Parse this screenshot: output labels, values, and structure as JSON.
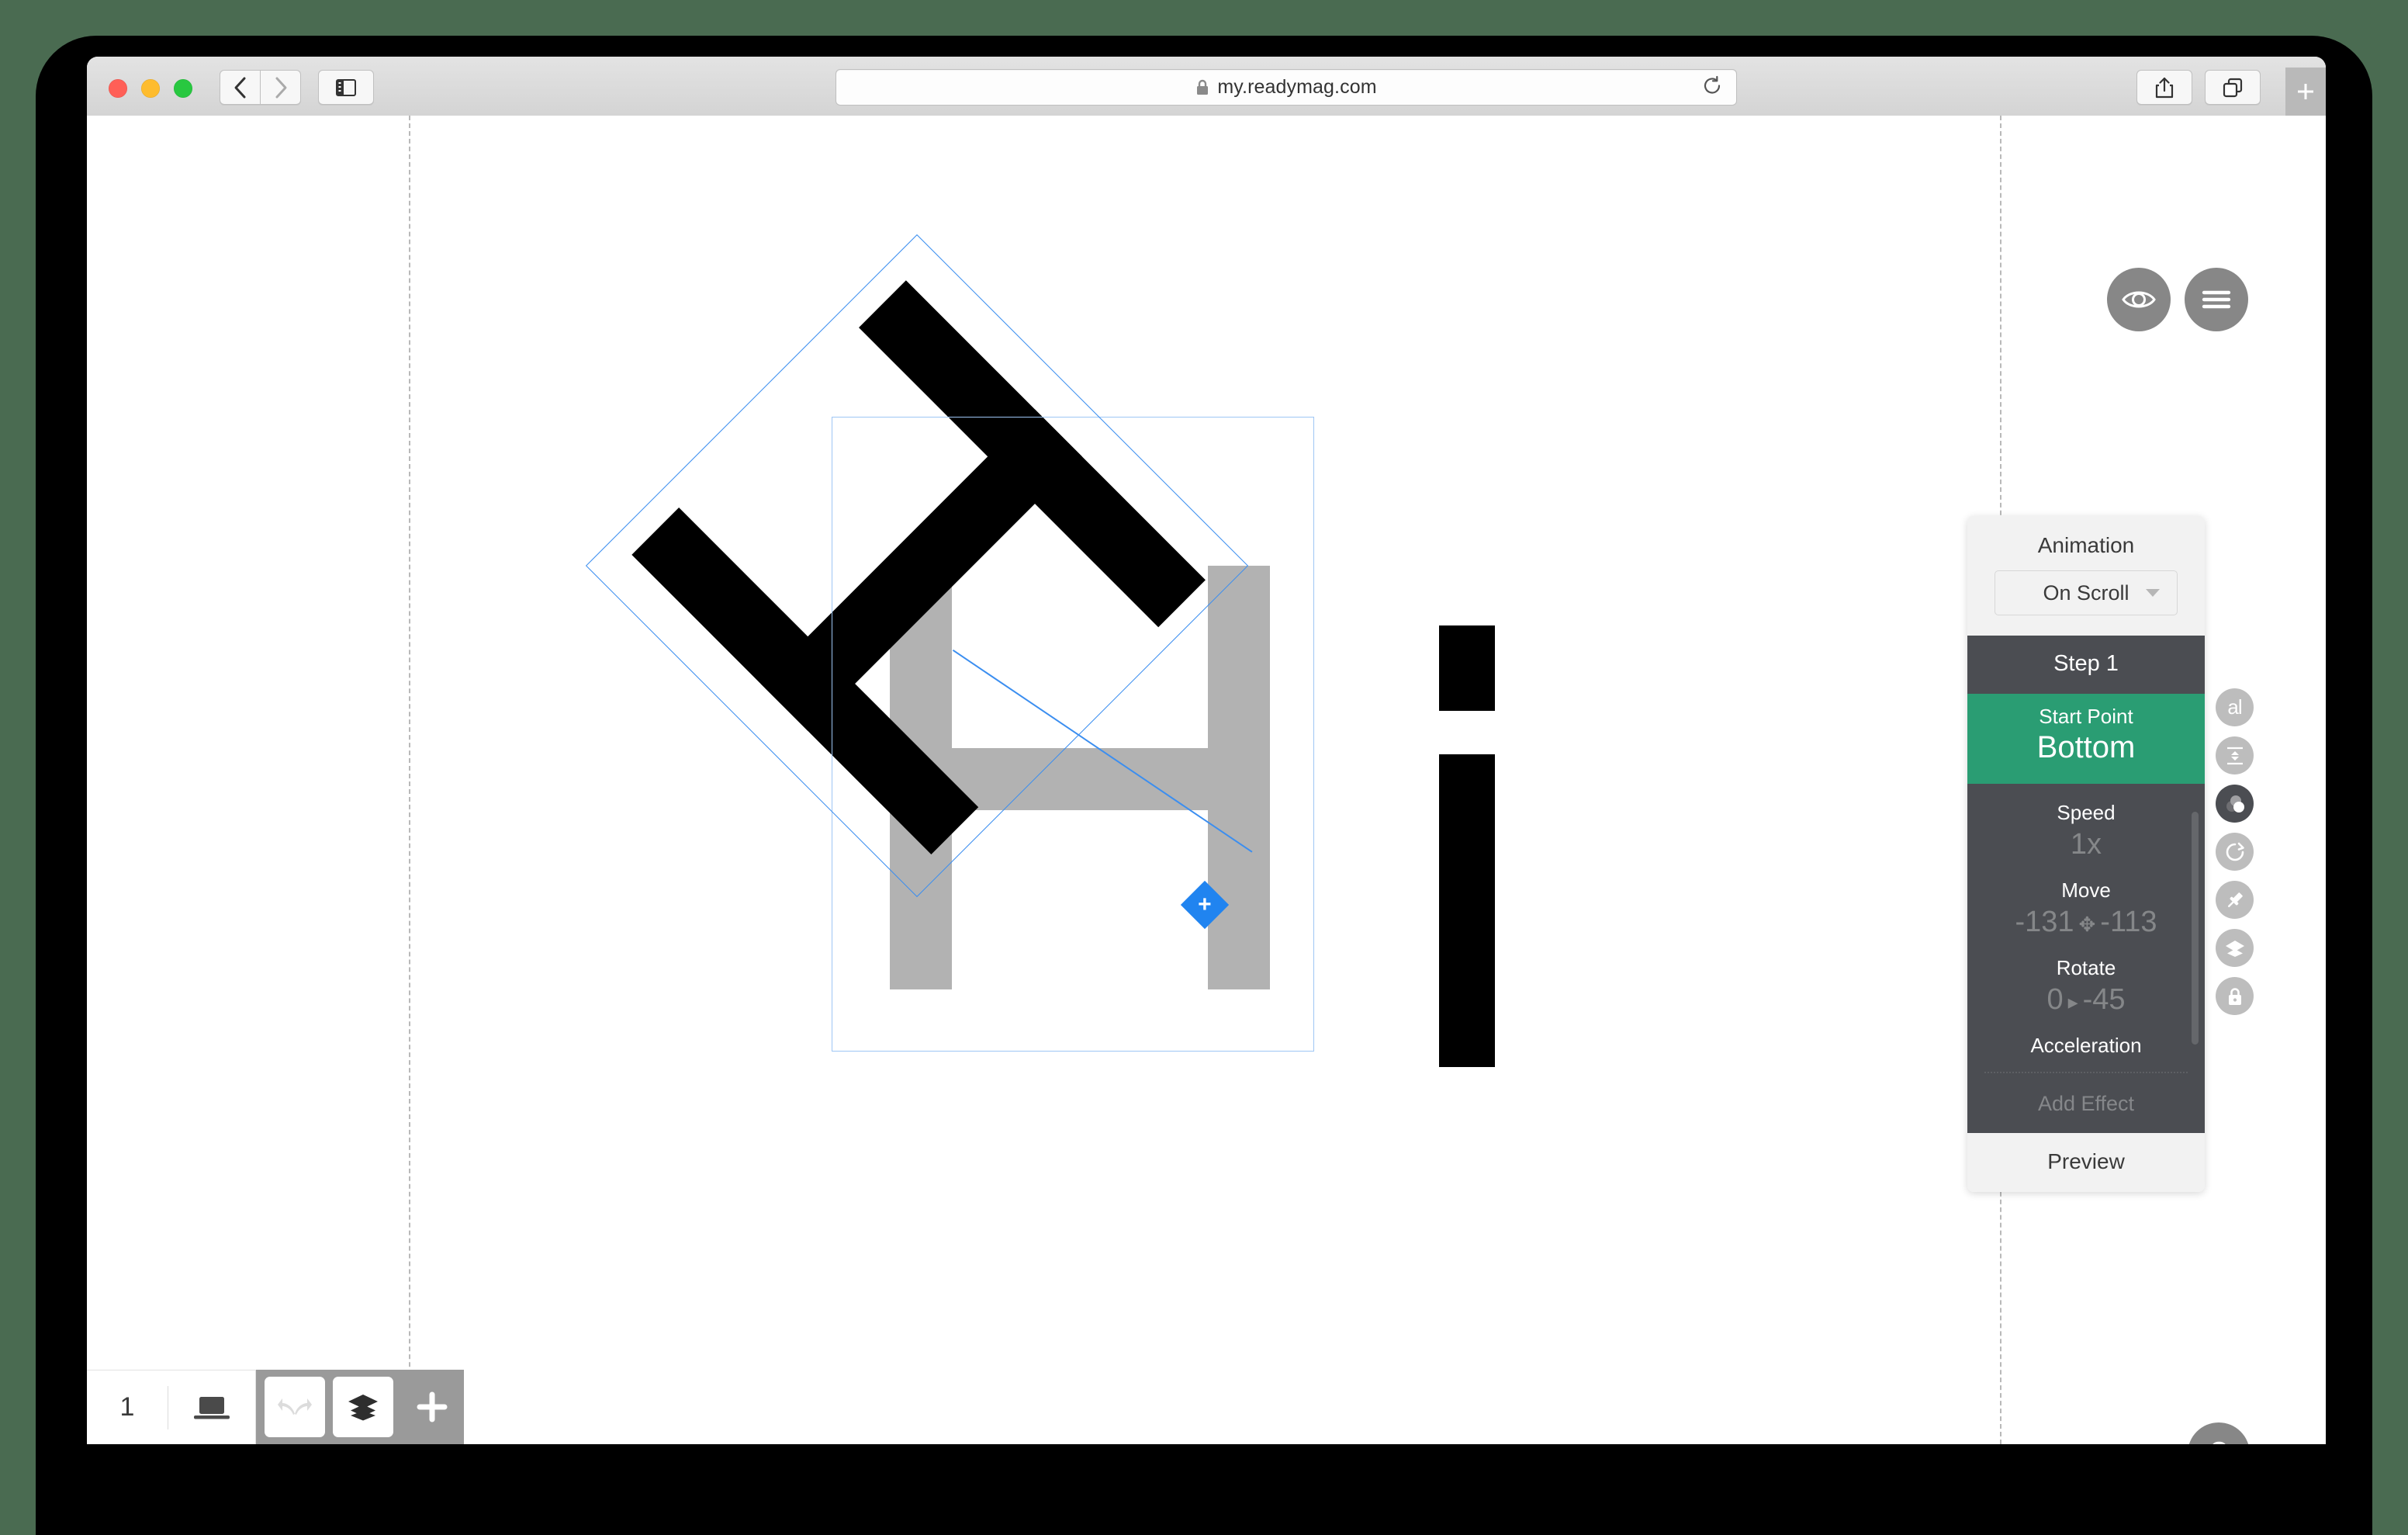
{
  "browser": {
    "url": "my.readymag.com",
    "lock_icon": "lock-icon",
    "back_icon": "chevron-left-icon",
    "forward_icon": "chevron-right-icon",
    "sidebar_icon": "sidebar-toggle-icon",
    "reload_icon": "reload-icon",
    "share_icon": "share-icon",
    "tabs_icon": "tab-overview-icon",
    "newtab_icon": "plus-icon",
    "traffic": [
      "close-red",
      "minimize-yellow",
      "zoom-green"
    ]
  },
  "canvas": {
    "floating": {
      "preview_eye_icon": "eye-icon",
      "menu_icon": "hamburger-menu-icon",
      "help_label": "?"
    },
    "selection_handle_icon": "move-plus-handle-icon",
    "letters": [
      "H",
      "H",
      "i"
    ]
  },
  "animation": {
    "title": "Animation",
    "trigger_value": "On Scroll",
    "trigger_caret_icon": "chevron-down-icon",
    "step_label": "Step 1",
    "start_point": {
      "label": "Start Point",
      "value": "Bottom"
    },
    "properties": [
      {
        "label": "Speed",
        "value": "1x",
        "icon": ""
      },
      {
        "label": "Move",
        "value_left": "-131",
        "icon": "move-arrows-icon",
        "value_right": "-113"
      },
      {
        "label": "Rotate",
        "value_left": "0",
        "icon": "play-triangle-icon",
        "value_right": "-45"
      }
    ],
    "acceleration_label": "Acceleration",
    "add_effect_label": "Add Effect",
    "preview_label": "Preview",
    "accent_green": "#2a9d73",
    "panel_dark": "#4b4d52",
    "panel_light": "#f2f2f2"
  },
  "rail": [
    {
      "name": "text-tool",
      "icon": "al-text-icon",
      "active": false
    },
    {
      "name": "align-tool",
      "icon": "vertical-align-icon",
      "active": false
    },
    {
      "name": "effects-tool",
      "icon": "overlapping-circles-icon",
      "active": true
    },
    {
      "name": "animation-tool",
      "icon": "rotate-clockwise-icon",
      "active": false
    },
    {
      "name": "pin-tool",
      "icon": "pushpin-icon",
      "active": false
    },
    {
      "name": "layers-tool",
      "icon": "layers-stack-icon",
      "active": false
    },
    {
      "name": "lock-tool",
      "icon": "padlock-icon",
      "active": false
    }
  ],
  "bottom_bar": {
    "page_number": "1",
    "device_icon": "laptop-icon",
    "undo_redo_icon": "undo-redo-arrows-icon",
    "layers_icon": "layers-stack-icon",
    "add_icon": "plus-icon"
  }
}
